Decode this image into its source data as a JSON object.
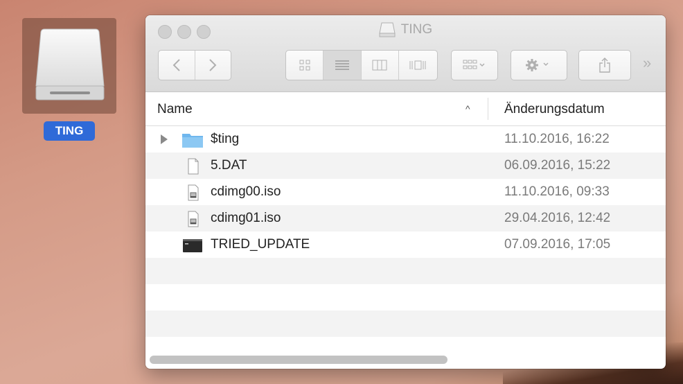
{
  "desktop": {
    "drive_label": "TING"
  },
  "window": {
    "title": "TING",
    "more_label": "»",
    "columns": {
      "name": "Name",
      "date": "Änderungsdatum",
      "sort_indicator": "^"
    },
    "files": [
      {
        "name": "$ting",
        "date": "11.10.2016, 16:22",
        "icon": "folder-icon",
        "expandable": true
      },
      {
        "name": "5.DAT",
        "date": "06.09.2016, 15:22",
        "icon": "document-icon",
        "expandable": false
      },
      {
        "name": "cdimg00.iso",
        "date": "11.10.2016, 09:33",
        "icon": "disk-image-icon",
        "expandable": false
      },
      {
        "name": "cdimg01.iso",
        "date": "29.04.2016, 12:42",
        "icon": "disk-image-icon",
        "expandable": false
      },
      {
        "name": "TRIED_UPDATE",
        "date": "07.09.2016, 17:05",
        "icon": "terminal-icon",
        "expandable": false
      }
    ]
  },
  "colors": {
    "selection": "#2f6ad8",
    "folder": "#6fb7ee"
  }
}
